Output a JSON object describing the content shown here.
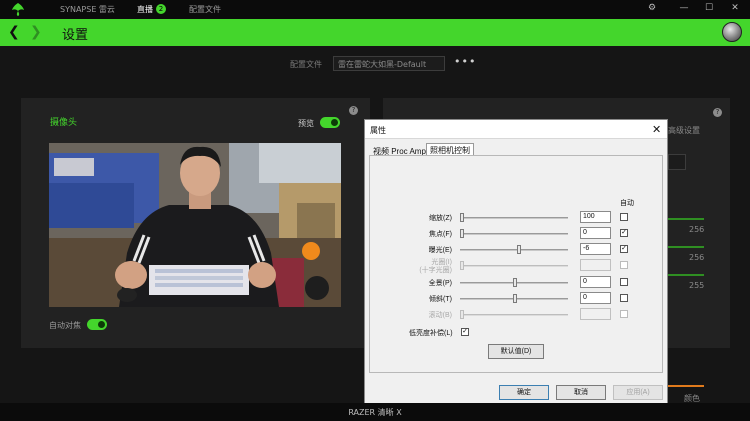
{
  "topbar": {
    "tabs": [
      {
        "label": "SYNAPSE 雷云"
      },
      {
        "label": "直播",
        "badge": "2"
      },
      {
        "label": "配置文件"
      }
    ],
    "accent": "#44d62c"
  },
  "header": {
    "title": "设置"
  },
  "profile": {
    "label": "配置文件",
    "value": "雷在雷蛇大如黑-Default",
    "more": "•••"
  },
  "camera_panel": {
    "title": "摄像头",
    "preview_label": "预览",
    "preview_on": true,
    "autofocus_label": "自动对焦",
    "autofocus_on": true
  },
  "dialog": {
    "title": "属性",
    "close": "✕",
    "tabs": [
      {
        "label": "视频 Proc Amp"
      },
      {
        "label": "照相机控制"
      }
    ],
    "auto_header": "自动",
    "properties": [
      {
        "label": "缩放(Z)",
        "value": "100",
        "slider": 0.0,
        "auto": false,
        "enabled": true
      },
      {
        "label": "焦点(F)",
        "value": "0",
        "slider": 0.0,
        "auto": true,
        "enabled": true
      },
      {
        "label": "曝光(E)",
        "value": "-6",
        "slider": 0.55,
        "auto": true,
        "enabled": true
      },
      {
        "label": "光圈(I)\n(十字光圈)",
        "value": "",
        "slider": 0.0,
        "auto": false,
        "enabled": false
      },
      {
        "label": "全景(P)",
        "value": "0",
        "slider": 0.5,
        "auto": false,
        "enabled": true
      },
      {
        "label": "倾斜(T)",
        "value": "0",
        "slider": 0.5,
        "auto": false,
        "enabled": true
      },
      {
        "label": "滚动(B)",
        "value": "",
        "slider": 0.0,
        "auto": false,
        "enabled": false
      }
    ],
    "low_light_label": "低亮度补偿(L)",
    "low_light_checked": true,
    "default_button": "默认值(D)",
    "ok_button": "确定",
    "cancel_button": "取消",
    "apply_button": "应用(A)"
  },
  "right_panel": {
    "partial_title": "高级设置",
    "values": [
      "256",
      "256",
      "255"
    ],
    "bottom_label": "颜色"
  },
  "footer": {
    "text": "RAZER 清晰 X"
  }
}
